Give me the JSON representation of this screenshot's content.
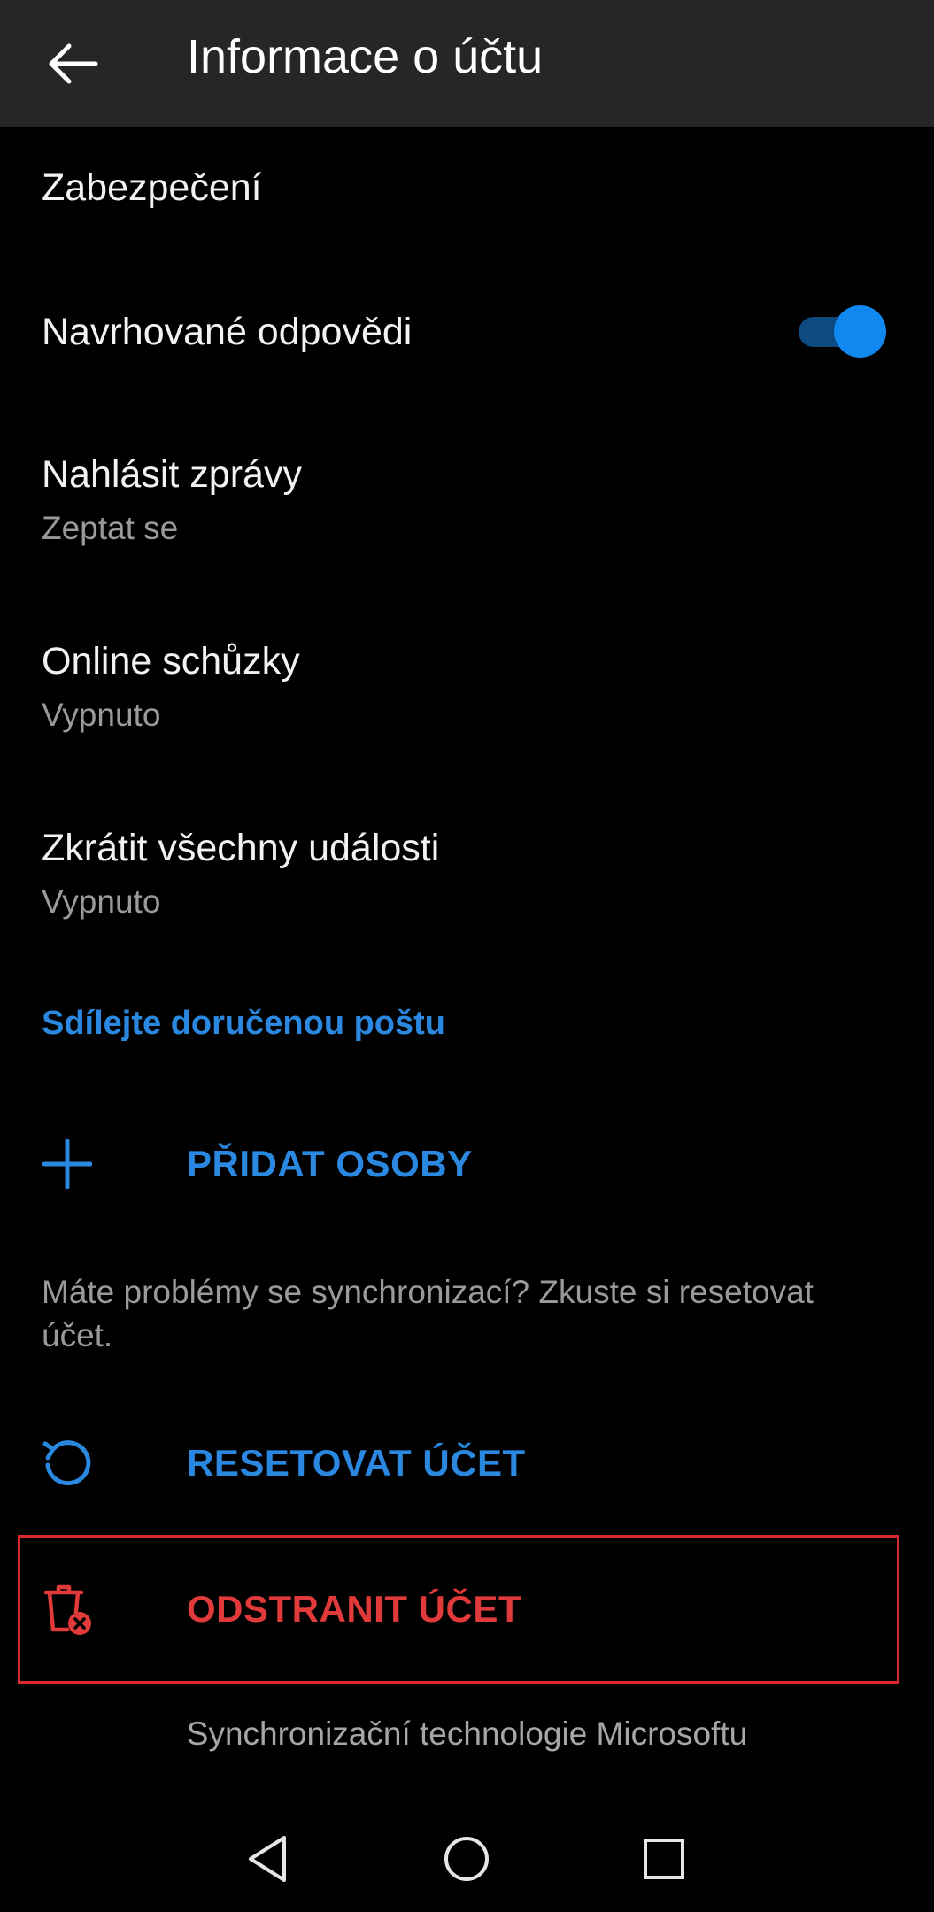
{
  "header": {
    "title": "Informace o účtu",
    "back_icon": "arrow-left-icon"
  },
  "settings": {
    "security": {
      "title": "Zabezpečení"
    },
    "suggested_replies": {
      "title": "Navrhované odpovědi",
      "enabled": true
    },
    "report_messages": {
      "title": "Nahlásit zprávy",
      "value": "Zeptat se"
    },
    "online_meetings": {
      "title": "Online schůzky",
      "value": "Vypnuto"
    },
    "shorten_events": {
      "title": "Zkrátit všechny události",
      "value": "Vypnuto"
    }
  },
  "share_inbox": {
    "heading": "Sdílejte doručenou poštu",
    "add_people_label": "PŘIDAT OSOBY",
    "add_icon": "plus-icon"
  },
  "reset": {
    "helper_text": "Máte problémy se synchronizací? Zkuste si resetovat účet.",
    "reset_label": "RESETOVAT ÚČET",
    "reset_icon": "refresh-icon"
  },
  "delete": {
    "label": "ODSTRANIT ÚČET",
    "icon": "trash-x-icon"
  },
  "footer": {
    "text": "Synchronizační technologie Microsoftu"
  },
  "nav": {
    "back_icon": "nav-back-triangle-icon",
    "home_icon": "nav-home-circle-icon",
    "recents_icon": "nav-recents-square-icon"
  },
  "colors": {
    "accent_blue": "#2a88e0",
    "danger_red": "#e03a3a",
    "toggle_on": "#1188f0",
    "app_bar": "#262626",
    "background": "#000000"
  }
}
